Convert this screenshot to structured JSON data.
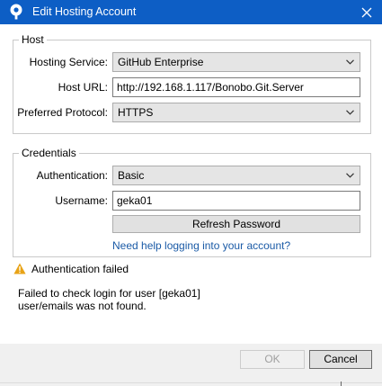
{
  "window": {
    "title": "Edit Hosting Account",
    "icon": "sourcetree-icon",
    "close_icon": "close-icon",
    "accent_color": "#0d5ec5"
  },
  "host": {
    "group_label": "Host",
    "service_label": "Hosting Service:",
    "service_value": "GitHub Enterprise",
    "url_label": "Host URL:",
    "url_value": "http://192.168.1.117/Bonobo.Git.Server",
    "protocol_label": "Preferred Protocol:",
    "protocol_value": "HTTPS"
  },
  "credentials": {
    "group_label": "Credentials",
    "auth_label": "Authentication:",
    "auth_value": "Basic",
    "username_label": "Username:",
    "username_value": "geka01",
    "refresh_button": "Refresh Password",
    "help_link": "Need help logging into your account?"
  },
  "status": {
    "icon": "warning-icon",
    "title": "Authentication failed",
    "line1": "Failed to check login for user [geka01]",
    "line2": "user/emails was not found."
  },
  "footer": {
    "ok_label": "OK",
    "cancel_label": "Cancel"
  }
}
